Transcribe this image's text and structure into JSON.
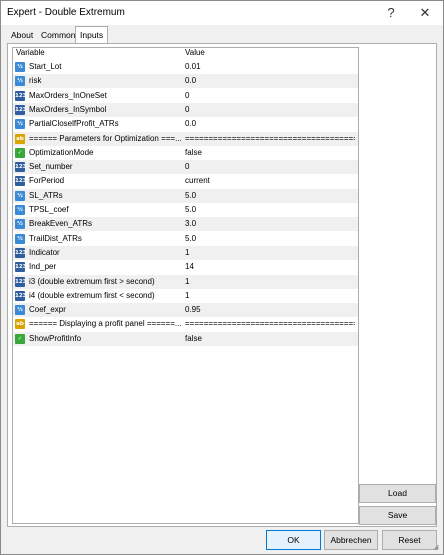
{
  "window": {
    "title": "Expert - Double Extremum",
    "help_glyph": "?",
    "close_glyph": "✕"
  },
  "tabs": [
    {
      "label": "About"
    },
    {
      "label": "Common"
    },
    {
      "label": "Inputs"
    }
  ],
  "grid": {
    "col_variable": "Variable",
    "col_value": "Value",
    "rows": [
      {
        "icon": "double-type-icon",
        "glyph": "½",
        "var": "Start_Lot",
        "val": "0.01"
      },
      {
        "icon": "double-type-icon",
        "glyph": "½",
        "var": "risk",
        "val": "0.0"
      },
      {
        "icon": "integer-type-icon",
        "glyph": "123",
        "var": "MaxOrders_InOneSet",
        "val": "0"
      },
      {
        "icon": "integer-type-icon",
        "glyph": "123",
        "var": "MaxOrders_InSymbol",
        "val": "0"
      },
      {
        "icon": "double-type-icon",
        "glyph": "½",
        "var": "PartialCloselfProfit_ATRs",
        "val": "0.0"
      },
      {
        "icon": "string-type-icon",
        "glyph": "ab",
        "var": "====== Parameters for Optimization ===...",
        "val": "=========================================..."
      },
      {
        "icon": "bool-type-icon",
        "glyph": "✓",
        "var": "OptimizationMode",
        "val": "false"
      },
      {
        "icon": "integer-type-icon",
        "glyph": "123",
        "var": "Set_number",
        "val": "0"
      },
      {
        "icon": "integer-type-icon",
        "glyph": "123",
        "var": "ForPeriod",
        "val": "current"
      },
      {
        "icon": "double-type-icon",
        "glyph": "½",
        "var": "SL_ATRs",
        "val": "5.0"
      },
      {
        "icon": "double-type-icon",
        "glyph": "½",
        "var": "TPSL_coef",
        "val": "5.0"
      },
      {
        "icon": "double-type-icon",
        "glyph": "½",
        "var": "BreakEven_ATRs",
        "val": "3.0"
      },
      {
        "icon": "double-type-icon",
        "glyph": "½",
        "var": "TrailDist_ATRs",
        "val": "5.0"
      },
      {
        "icon": "integer-type-icon",
        "glyph": "123",
        "var": "Indicator",
        "val": "1"
      },
      {
        "icon": "integer-type-icon",
        "glyph": "123",
        "var": "Ind_per",
        "val": "14"
      },
      {
        "icon": "integer-type-icon",
        "glyph": "123",
        "var": "i3 (double extremum first > second)",
        "val": "1"
      },
      {
        "icon": "integer-type-icon",
        "glyph": "123",
        "var": "i4 (double extremum first < second)",
        "val": "1"
      },
      {
        "icon": "double-type-icon",
        "glyph": "½",
        "var": "Coef_expr",
        "val": "0.95"
      },
      {
        "icon": "string-type-icon",
        "glyph": "ab",
        "var": "====== Displaying a profit panel ======...",
        "val": "=========================================..."
      },
      {
        "icon": "bool-type-icon",
        "glyph": "✓",
        "var": "ShowProfitInfo",
        "val": "false"
      }
    ]
  },
  "buttons": {
    "load": "Load",
    "save": "Save",
    "ok": "OK",
    "cancel": "Abbrechen",
    "reset": "Reset"
  },
  "colors": {
    "double_icon": "#3b8ad6",
    "integer_icon": "#2f5f9f",
    "string_icon": "#d9a400",
    "bool_icon": "#3aa73a",
    "default_button_border": "#0078d7"
  }
}
